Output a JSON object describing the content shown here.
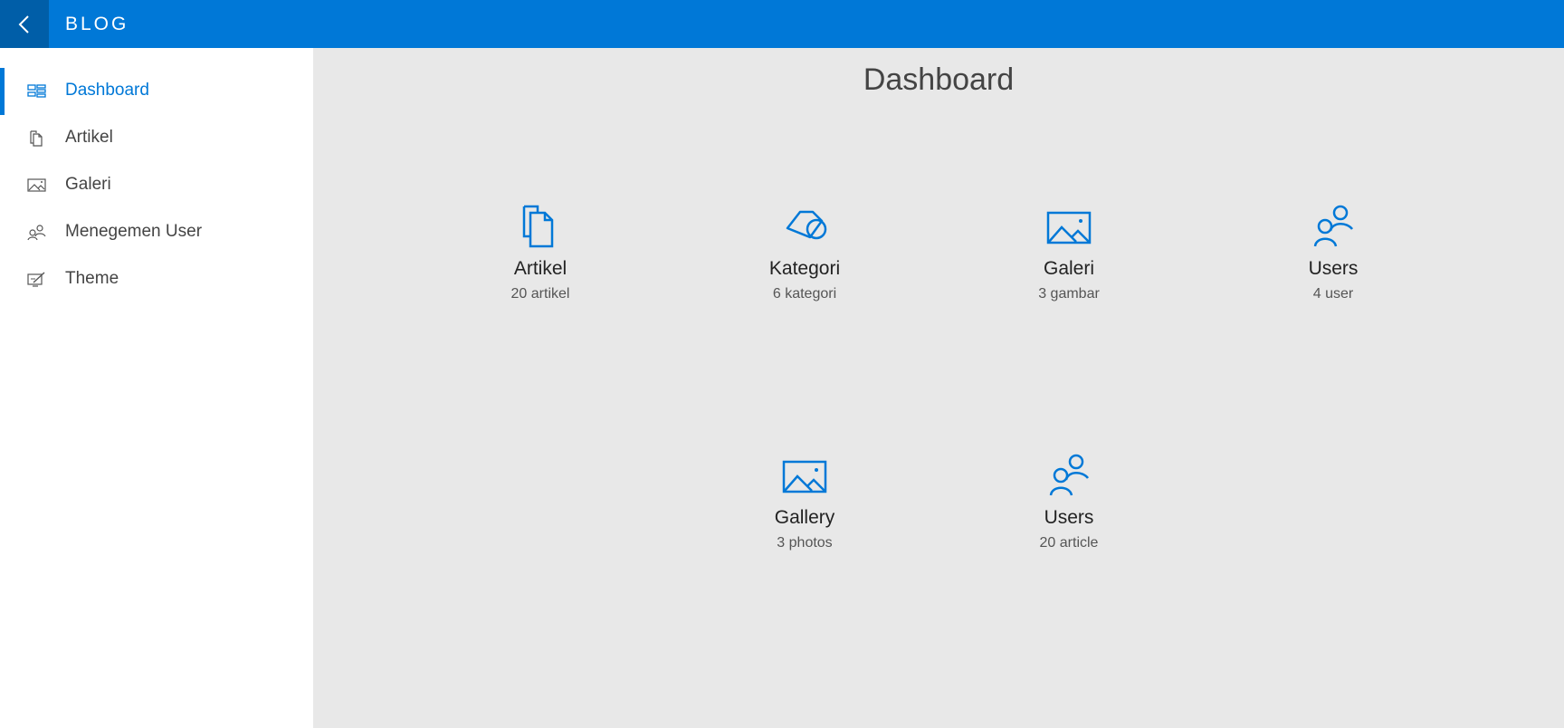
{
  "header": {
    "title": "BLOG",
    "back_icon": "chevron-left-icon",
    "color": "#0078d7"
  },
  "sidebar": {
    "items": [
      {
        "label": "Dashboard",
        "icon": "dashboard-icon",
        "active": true
      },
      {
        "label": "Artikel",
        "icon": "documents-icon",
        "active": false
      },
      {
        "label": "Galeri",
        "icon": "image-icon",
        "active": false
      },
      {
        "label": "Menegemen User",
        "icon": "users-icon",
        "active": false
      },
      {
        "label": "Theme",
        "icon": "theme-icon",
        "active": false
      }
    ]
  },
  "main": {
    "title": "Dashboard",
    "tiles": [
      {
        "name": "Artikel",
        "count": "20 artikel",
        "icon": "documents-icon"
      },
      {
        "name": "Kategori",
        "count": "6 kategori",
        "icon": "tag-icon"
      },
      {
        "name": "Galeri",
        "count": "3 gambar",
        "icon": "image-icon"
      },
      {
        "name": "Users",
        "count": "4 user",
        "icon": "users-icon"
      },
      {
        "name": "Gallery",
        "count": "3 photos",
        "icon": "image-icon"
      },
      {
        "name": "Users",
        "count": "20 article",
        "icon": "users-icon"
      }
    ]
  },
  "colors": {
    "accent": "#0078d7",
    "background": "#e8e8e8",
    "sidebar": "#ffffff"
  }
}
